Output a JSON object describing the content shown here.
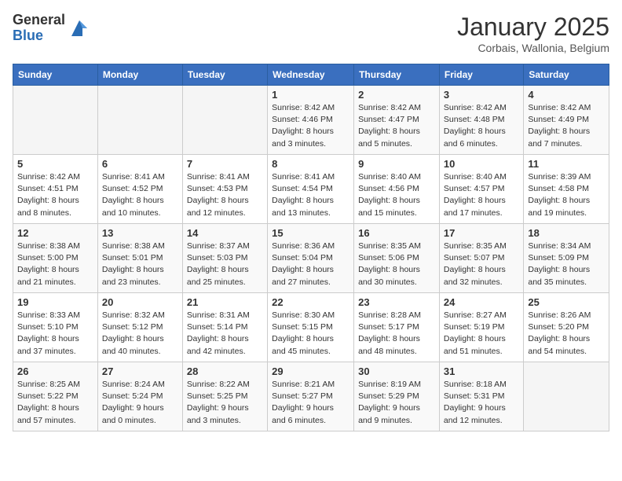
{
  "header": {
    "logo_general": "General",
    "logo_blue": "Blue",
    "month_title": "January 2025",
    "subtitle": "Corbais, Wallonia, Belgium"
  },
  "weekdays": [
    "Sunday",
    "Monday",
    "Tuesday",
    "Wednesday",
    "Thursday",
    "Friday",
    "Saturday"
  ],
  "weeks": [
    [
      {
        "day": "",
        "info": ""
      },
      {
        "day": "",
        "info": ""
      },
      {
        "day": "",
        "info": ""
      },
      {
        "day": "1",
        "info": "Sunrise: 8:42 AM\nSunset: 4:46 PM\nDaylight: 8 hours\nand 3 minutes."
      },
      {
        "day": "2",
        "info": "Sunrise: 8:42 AM\nSunset: 4:47 PM\nDaylight: 8 hours\nand 5 minutes."
      },
      {
        "day": "3",
        "info": "Sunrise: 8:42 AM\nSunset: 4:48 PM\nDaylight: 8 hours\nand 6 minutes."
      },
      {
        "day": "4",
        "info": "Sunrise: 8:42 AM\nSunset: 4:49 PM\nDaylight: 8 hours\nand 7 minutes."
      }
    ],
    [
      {
        "day": "5",
        "info": "Sunrise: 8:42 AM\nSunset: 4:51 PM\nDaylight: 8 hours\nand 8 minutes."
      },
      {
        "day": "6",
        "info": "Sunrise: 8:41 AM\nSunset: 4:52 PM\nDaylight: 8 hours\nand 10 minutes."
      },
      {
        "day": "7",
        "info": "Sunrise: 8:41 AM\nSunset: 4:53 PM\nDaylight: 8 hours\nand 12 minutes."
      },
      {
        "day": "8",
        "info": "Sunrise: 8:41 AM\nSunset: 4:54 PM\nDaylight: 8 hours\nand 13 minutes."
      },
      {
        "day": "9",
        "info": "Sunrise: 8:40 AM\nSunset: 4:56 PM\nDaylight: 8 hours\nand 15 minutes."
      },
      {
        "day": "10",
        "info": "Sunrise: 8:40 AM\nSunset: 4:57 PM\nDaylight: 8 hours\nand 17 minutes."
      },
      {
        "day": "11",
        "info": "Sunrise: 8:39 AM\nSunset: 4:58 PM\nDaylight: 8 hours\nand 19 minutes."
      }
    ],
    [
      {
        "day": "12",
        "info": "Sunrise: 8:38 AM\nSunset: 5:00 PM\nDaylight: 8 hours\nand 21 minutes."
      },
      {
        "day": "13",
        "info": "Sunrise: 8:38 AM\nSunset: 5:01 PM\nDaylight: 8 hours\nand 23 minutes."
      },
      {
        "day": "14",
        "info": "Sunrise: 8:37 AM\nSunset: 5:03 PM\nDaylight: 8 hours\nand 25 minutes."
      },
      {
        "day": "15",
        "info": "Sunrise: 8:36 AM\nSunset: 5:04 PM\nDaylight: 8 hours\nand 27 minutes."
      },
      {
        "day": "16",
        "info": "Sunrise: 8:35 AM\nSunset: 5:06 PM\nDaylight: 8 hours\nand 30 minutes."
      },
      {
        "day": "17",
        "info": "Sunrise: 8:35 AM\nSunset: 5:07 PM\nDaylight: 8 hours\nand 32 minutes."
      },
      {
        "day": "18",
        "info": "Sunrise: 8:34 AM\nSunset: 5:09 PM\nDaylight: 8 hours\nand 35 minutes."
      }
    ],
    [
      {
        "day": "19",
        "info": "Sunrise: 8:33 AM\nSunset: 5:10 PM\nDaylight: 8 hours\nand 37 minutes."
      },
      {
        "day": "20",
        "info": "Sunrise: 8:32 AM\nSunset: 5:12 PM\nDaylight: 8 hours\nand 40 minutes."
      },
      {
        "day": "21",
        "info": "Sunrise: 8:31 AM\nSunset: 5:14 PM\nDaylight: 8 hours\nand 42 minutes."
      },
      {
        "day": "22",
        "info": "Sunrise: 8:30 AM\nSunset: 5:15 PM\nDaylight: 8 hours\nand 45 minutes."
      },
      {
        "day": "23",
        "info": "Sunrise: 8:28 AM\nSunset: 5:17 PM\nDaylight: 8 hours\nand 48 minutes."
      },
      {
        "day": "24",
        "info": "Sunrise: 8:27 AM\nSunset: 5:19 PM\nDaylight: 8 hours\nand 51 minutes."
      },
      {
        "day": "25",
        "info": "Sunrise: 8:26 AM\nSunset: 5:20 PM\nDaylight: 8 hours\nand 54 minutes."
      }
    ],
    [
      {
        "day": "26",
        "info": "Sunrise: 8:25 AM\nSunset: 5:22 PM\nDaylight: 8 hours\nand 57 minutes."
      },
      {
        "day": "27",
        "info": "Sunrise: 8:24 AM\nSunset: 5:24 PM\nDaylight: 9 hours\nand 0 minutes."
      },
      {
        "day": "28",
        "info": "Sunrise: 8:22 AM\nSunset: 5:25 PM\nDaylight: 9 hours\nand 3 minutes."
      },
      {
        "day": "29",
        "info": "Sunrise: 8:21 AM\nSunset: 5:27 PM\nDaylight: 9 hours\nand 6 minutes."
      },
      {
        "day": "30",
        "info": "Sunrise: 8:19 AM\nSunset: 5:29 PM\nDaylight: 9 hours\nand 9 minutes."
      },
      {
        "day": "31",
        "info": "Sunrise: 8:18 AM\nSunset: 5:31 PM\nDaylight: 9 hours\nand 12 minutes."
      },
      {
        "day": "",
        "info": ""
      }
    ]
  ]
}
